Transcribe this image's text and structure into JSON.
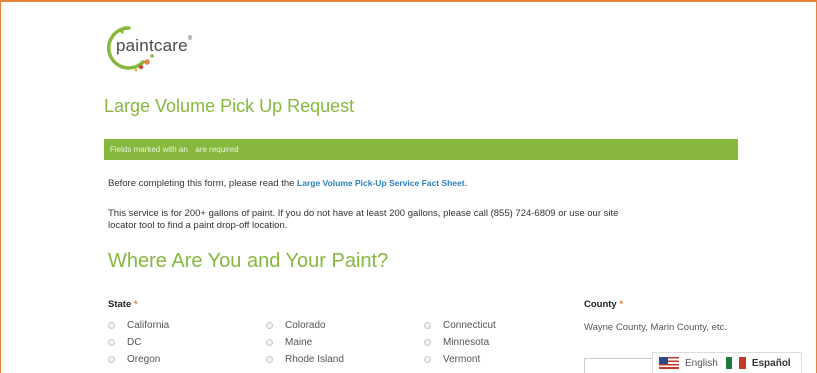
{
  "logo": {
    "text": "paintcare",
    "tm": "®"
  },
  "page_title": "Large Volume Pick Up Request",
  "required_bar": {
    "prefix": "Fields marked with an ",
    "star": "*",
    "suffix": " are required"
  },
  "intro": {
    "before": "Before completing this form, please read the ",
    "link": "Large Volume Pick-Up Service Fact Sheet.",
    "note": "This service is for 200+ gallons of paint. If you do not have at least 200 gallons, please call (855) 724-6809 or use our site locator tool to find a paint drop-off location."
  },
  "section_title": "Where Are You and Your Paint?",
  "state": {
    "label": "State",
    "star": "*",
    "options": [
      "California",
      "Colorado",
      "Connecticut",
      "DC",
      "Maine",
      "Minnesota",
      "Oregon",
      "Rhode Island",
      "Vermont"
    ]
  },
  "county": {
    "label": "County",
    "star": "*",
    "hint": "Wayne County, Marin County, etc."
  },
  "language": {
    "english": "English",
    "spanish": "Español"
  },
  "colors": {
    "brand_green": "#86b83e",
    "accent_orange": "#e8823a",
    "link_blue": "#2c7fb8"
  }
}
